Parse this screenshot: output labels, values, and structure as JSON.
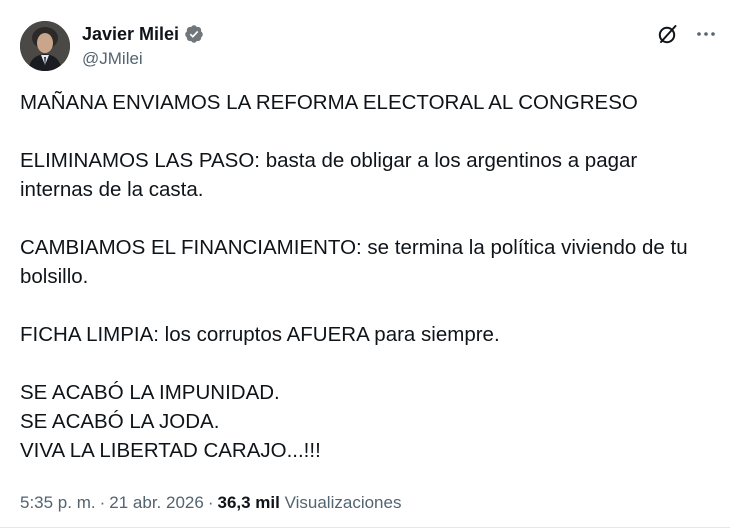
{
  "author": {
    "name": "Javier Milei",
    "handle": "@JMilei",
    "verified_color": "#71767b"
  },
  "tweet": {
    "paragraphs": [
      "MAÑANA ENVIAMOS LA REFORMA ELECTORAL AL CONGRESO",
      "ELIMINAMOS LAS PASO: basta de obligar a los argentinos a pagar\ninternas de la casta.",
      "CAMBIAMOS EL FINANCIAMIENTO: se termina la política viviendo de tu\nbolsillo.",
      "FICHA LIMPIA: los corruptos AFUERA para siempre.",
      "SE ACABÓ LA IMPUNIDAD.\nSE ACABÓ LA JODA.\nVIVA LA LIBERTAD CARAJO...!!!"
    ]
  },
  "meta": {
    "time": "5:35 p. m.",
    "date": "21 abr. 2026",
    "separator": "·",
    "views_count": "36,3 mil",
    "views_label": "Visualizaciones"
  },
  "icons": {
    "grok": "grok-icon",
    "more": "more-icon",
    "verified": "verified-badge-icon"
  }
}
